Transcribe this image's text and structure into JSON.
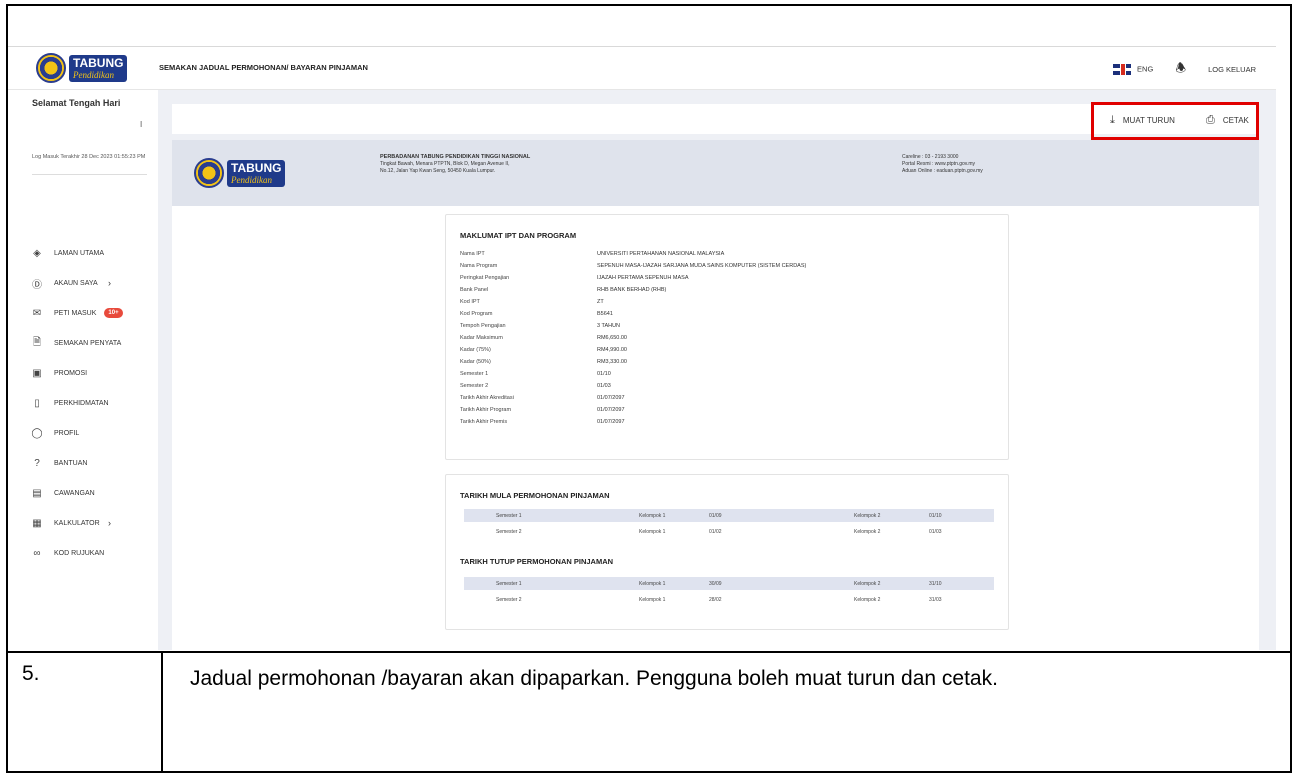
{
  "topbar": {
    "logo_top": "TABUNG",
    "logo_bottom": "Pendidikan",
    "title": "SEMAKAN JADUAL PERMOHONAN/ BAYARAN PINJAMAN",
    "lang": "ENG",
    "logout": "LOG KELUAR"
  },
  "sidebar": {
    "greeting": "Selamat Tengah Hari",
    "greeting_sub": "I",
    "last_login": "Log Masuk Terakhir 28 Dec 2023 01:55:23 PM",
    "items": [
      {
        "label": "LAMAN UTAMA",
        "icon": "layers-icon"
      },
      {
        "label": "AKAUN SAYA",
        "icon": "dollar-icon"
      },
      {
        "label": "PETI MASUK",
        "icon": "mail-icon",
        "badge": "10+"
      },
      {
        "label": "SEMAKAN PENYATA",
        "icon": "document-icon"
      },
      {
        "label": "PROMOSI",
        "icon": "gift-icon"
      },
      {
        "label": "PERKHIDMATAN",
        "icon": "phone-icon"
      },
      {
        "label": "PROFIL",
        "icon": "user-icon"
      },
      {
        "label": "BANTUAN",
        "icon": "help-icon"
      },
      {
        "label": "CAWANGAN",
        "icon": "building-icon"
      },
      {
        "label": "KALKULATOR",
        "icon": "calculator-icon"
      },
      {
        "label": "KOD RUJUKAN",
        "icon": "link-icon"
      }
    ]
  },
  "actions": {
    "download": "MUAT TURUN",
    "print": "CETAK"
  },
  "header": {
    "logo_top": "TABUNG",
    "logo_bottom": "Pendidikan",
    "org_name": "PERBADANAN TABUNG PENDIDIKAN TINGGI NASIONAL",
    "addr1": "Tingkat Bawah, Menara PTPTN, Blok D, Megan Avenue II,",
    "addr2": "No.12, Jalan Yap Kwan Seng, 50450 Kuala Lumpur.",
    "careline": "Careline : 03 - 2193 3000",
    "portal": "Portal Resmi : www.ptptn.gov.my",
    "aduan": "Aduan Online : eaduan.ptptn.gov.my"
  },
  "ipt": {
    "title": "MAKLUMAT IPT DAN PROGRAM",
    "rows": [
      {
        "k": "Nama IPT",
        "v": "UNIVERSITI PERTAHANAN NASIONAL MALAYSIA"
      },
      {
        "k": "Nama Program",
        "v": "SEPENUH MASA-IJAZAH SARJANA MUDA SAINS KOMPUTER (SISTEM CERDAS)"
      },
      {
        "k": "Peringkat Pengajian",
        "v": "IJAZAH PERTAMA SEPENUH MASA"
      },
      {
        "k": "Bank Panel",
        "v": "RHB BANK BERHAD (RHB)"
      },
      {
        "k": "Kod IPT",
        "v": "ZT"
      },
      {
        "k": "Kod Program",
        "v": "B5641"
      },
      {
        "k": "Tempoh Pengajian",
        "v": "3 TAHUN"
      },
      {
        "k": "Kadar Maksimum",
        "v": "RM6,650.00"
      },
      {
        "k": "Kadar (75%)",
        "v": "RM4,990.00"
      },
      {
        "k": "Kadar (50%)",
        "v": "RM3,330.00"
      },
      {
        "k": "Semester 1",
        "v": "01/10"
      },
      {
        "k": "Semester 2",
        "v": "01/03"
      },
      {
        "k": "Tarikh Akhir Akreditasi",
        "v": "01/07/2097"
      },
      {
        "k": "Tarikh Akhir Program",
        "v": "01/07/2097"
      },
      {
        "k": "Tarikh Akhir Premis",
        "v": "01/07/2097"
      }
    ]
  },
  "schedule": {
    "open_title": "TARIKH MULA PERMOHONAN PINJAMAN",
    "open_rows": [
      {
        "sem": "Semester 1",
        "k1": "Kelompok 1",
        "d1": "01/09",
        "k2": "Kelompok 2",
        "d2": "01/10"
      },
      {
        "sem": "Semester 2",
        "k1": "Kelompok 1",
        "d1": "01/02",
        "k2": "Kelompok 2",
        "d2": "01/03"
      }
    ],
    "close_title": "TARIKH TUTUP PERMOHONAN PINJAMAN",
    "close_rows": [
      {
        "sem": "Semester 1",
        "k1": "Kelompok 1",
        "d1": "30/09",
        "k2": "Kelompok 2",
        "d2": "31/10"
      },
      {
        "sem": "Semester 2",
        "k1": "Kelompok 1",
        "d1": "28/02",
        "k2": "Kelompok 2",
        "d2": "31/03"
      }
    ]
  },
  "doc": {
    "step_number": "5.",
    "step_text": "Jadual permohonan /bayaran akan dipaparkan. Pengguna boleh muat turun dan cetak."
  },
  "colors": {
    "highlight": "#e00000",
    "brand_blue": "#1f3a8a",
    "brand_gold": "#f3c316",
    "badge": "#e84a3c"
  }
}
